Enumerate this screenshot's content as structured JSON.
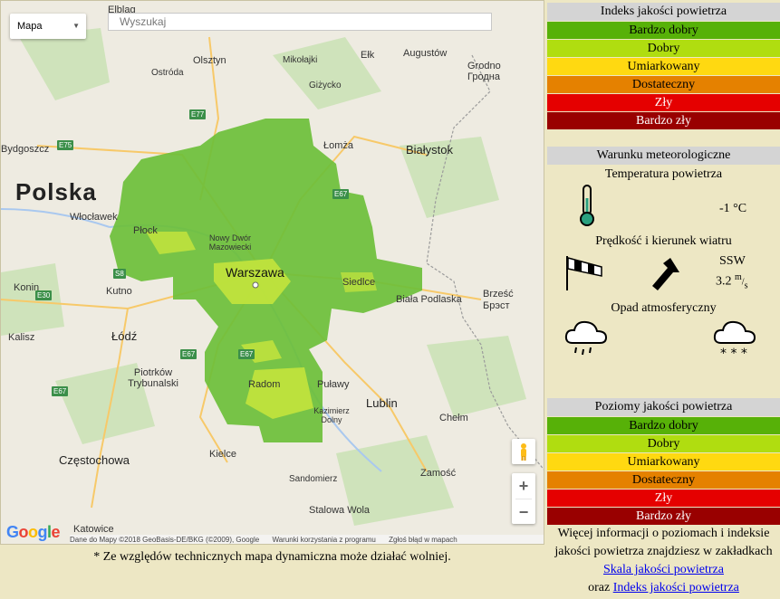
{
  "map": {
    "type_label": "Mapa",
    "search_placeholder": "Wyszukaj",
    "zoom_in": "+",
    "zoom_out": "−",
    "logo": "Google",
    "attribution": [
      "Dane do Mapy ©2018 GeoBasis-DE/BKG (©2009), Google",
      "Warunki korzystania z programu",
      "Zgłoś błąd w mapach"
    ],
    "country": "Polska",
    "cities": [
      "Elbląg",
      "Olsztyn",
      "Mikołajki",
      "Ełk",
      "Augustów",
      "Grodno",
      "Гродна",
      "Ostróda",
      "Giżycko",
      "Łomża",
      "Białystok",
      "Włocławek",
      "Płock",
      "Nowy Dwór Mazowiecki",
      "Warszawa",
      "Siedlce",
      "Biała Podlaska",
      "Brześć",
      "Брэст",
      "Kutno",
      "Konin",
      "Łódź",
      "Kalisz",
      "Piotrków Trybunalski",
      "Radom",
      "Puławy",
      "Kazimierz Dolny",
      "Lublin",
      "Chełm",
      "Kielce",
      "Częstochowa",
      "Zamość",
      "Sandomierz",
      "Stalowa Wola",
      "Katowice",
      "Bydgoszcz"
    ],
    "roads": [
      "E75",
      "E77",
      "E67",
      "E30",
      "E67",
      "E67",
      "E67",
      "S8",
      "E30"
    ]
  },
  "note": "* Ze względów technicznych mapa dynamiczna może działać wolniej.",
  "index_panel": {
    "title": "Indeks jakości powietrza",
    "levels": [
      "Bardzo dobry",
      "Dobry",
      "Umiarkowany",
      "Dostateczny",
      "Zły",
      "Bardzo zły"
    ]
  },
  "meteo": {
    "title": "Warunku meteorologiczne",
    "temp_title": "Temperatura powietrza",
    "temp_value": "-1 °C",
    "wind_title": "Prędkość i kierunek wiatru",
    "wind_dir": "SSW",
    "wind_speed": "3.2",
    "wind_unit_top": "m",
    "wind_unit_bottom": "s",
    "precip_title": "Opad atmosferyczny"
  },
  "levels_panel": {
    "title": "Poziomy jakości powietrza",
    "levels": [
      "Bardzo dobry",
      "Dobry",
      "Umiarkowany",
      "Dostateczny",
      "Zły",
      "Bardzo zły"
    ]
  },
  "info": {
    "text1": "Więcej informacji o poziomach i indeksie jakości powietrza znajdziesz w zakładkach",
    "link1": "Skala jakości powietrza",
    "oraz": "oraz",
    "link2": "Indeks jakości powietrza"
  },
  "colors": {
    "very_good": "#57b108",
    "good": "#b0dd10",
    "moderate": "#ffd911",
    "sufficient": "#e58100",
    "bad": "#e50000",
    "very_bad": "#990000",
    "overlay_green": "#6cbf3a",
    "overlay_lime": "#c8e63c"
  }
}
